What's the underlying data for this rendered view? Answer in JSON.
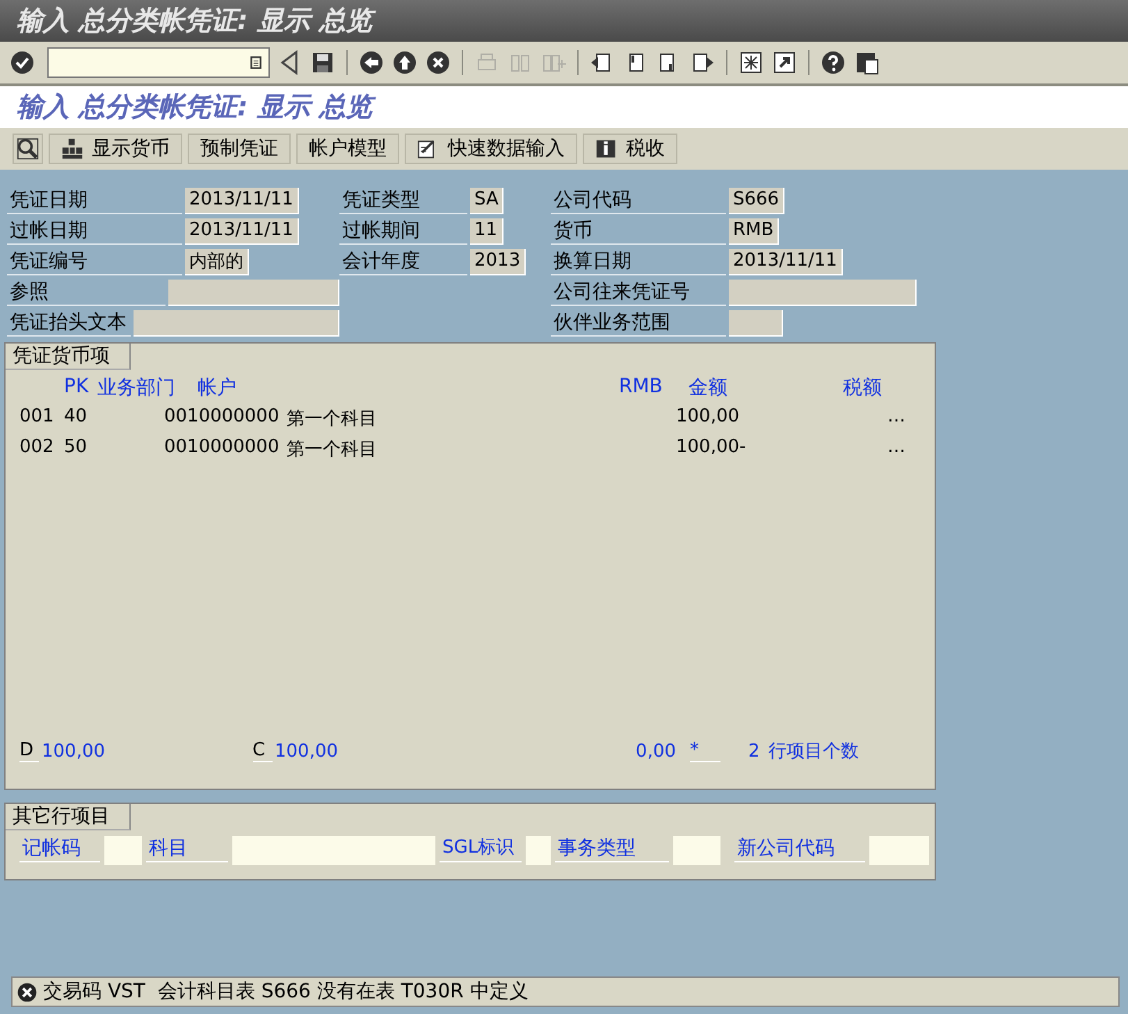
{
  "window": {
    "title": "输入 总分类帐凭证: 显示 总览"
  },
  "toolbar": {
    "groups": [
      [
        {
          "disabled": false
        }
      ],
      [
        {
          "disabled": false
        },
        {
          "disabled": false
        }
      ],
      [
        {
          "disabled": false
        },
        {
          "disabled": false
        },
        {
          "disabled": false
        }
      ],
      [
        {
          "disabled": true
        },
        {
          "disabled": true
        },
        {
          "disabled": true
        }
      ],
      [
        {
          "disabled": false
        },
        {
          "disabled": false
        },
        {
          "disabled": false
        },
        {
          "disabled": false
        }
      ],
      [
        {
          "disabled": false
        },
        {
          "disabled": false
        }
      ],
      [
        {
          "disabled": false
        },
        {
          "disabled": false
        }
      ]
    ]
  },
  "screen_title": "输入 总分类帐凭证: 显示 总览",
  "app_toolbar": [
    {
      "kind": "icon"
    },
    {
      "kind": "button",
      "label": "显示货币"
    },
    {
      "kind": "button",
      "label": "预制凭证"
    },
    {
      "kind": "button",
      "label": "帐户模型"
    },
    {
      "kind": "button",
      "label": "快速数据输入"
    },
    {
      "kind": "button",
      "label": "税收"
    }
  ],
  "header": {
    "rows": [
      {
        "left": {
          "label": "凭证日期",
          "value": "2013/11/11"
        },
        "middle": {
          "label": "凭证类型",
          "value": "SA"
        },
        "right": {
          "label": "公司代码",
          "value": "S666"
        }
      },
      {
        "left": {
          "label": "过帐日期",
          "value": "2013/11/11"
        },
        "middle": {
          "label": "过帐期间",
          "value": "11"
        },
        "right": {
          "label": "货币",
          "value": "RMB"
        }
      },
      {
        "left": {
          "label": "凭证编号",
          "value": "内部的"
        },
        "middle": {
          "label": "会计年度",
          "value": "2013"
        },
        "right": {
          "label": "换算日期",
          "value": "2013/11/11"
        }
      },
      {
        "left": {
          "label": "参照"
        },
        "right": {
          "label": "公司往来凭证号"
        }
      },
      {
        "left": {
          "label": "凭证抬头文本"
        },
        "right": {
          "label": "伙伴业务范围"
        }
      }
    ]
  },
  "items_panel": {
    "title": "凭证货币项",
    "columns": [
      "PK",
      "业务部门",
      "帐户",
      "RMB",
      "金额",
      "税额"
    ],
    "rows": [
      {
        "item": "001",
        "pk": "40",
        "account": "0010000000",
        "account_name": "第一个科目",
        "amount": "100,00",
        "tax": "…"
      },
      {
        "item": "002",
        "pk": "50",
        "account": "0010000000",
        "account_name": "第一个科目",
        "amount": "100,00-",
        "tax": "…"
      }
    ],
    "totals": {
      "debit_label": "D",
      "debit": "100,00",
      "credit_label": "C",
      "credit": "100,00",
      "balance": "0,00",
      "balance_flag": "*",
      "count": "2",
      "count_label": "行项目个数"
    }
  },
  "other_items": {
    "title": "其它行项目",
    "fields": [
      {
        "label": "记帐码"
      },
      {
        "label": "科目"
      },
      {
        "label": "SGL标识"
      },
      {
        "label": "事务类型"
      },
      {
        "label": "新公司代码"
      }
    ]
  },
  "status_bar": {
    "kind": "error",
    "message": "交易码 VST  会计科目表 S666 没有在表 T030R 中定义"
  }
}
